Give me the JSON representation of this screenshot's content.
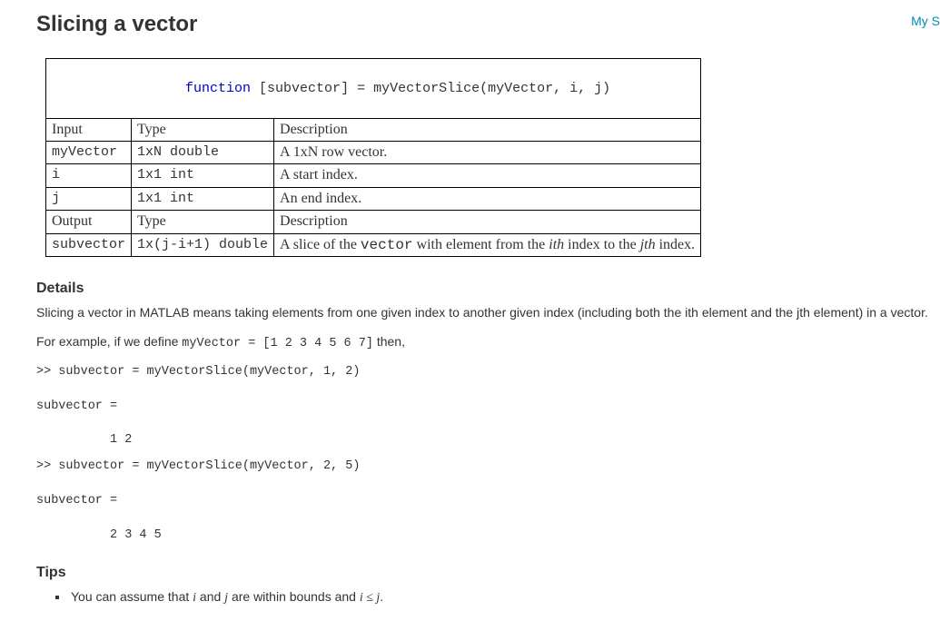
{
  "nav": {
    "link": "My S"
  },
  "title": "Slicing a vector",
  "signature": {
    "keyword": "function",
    "rest": " [subvector] = myVectorSlice(myVector, i, j)"
  },
  "table": {
    "input_header": {
      "c1": "Input",
      "c2": "Type",
      "c3": "Description"
    },
    "inputs": [
      {
        "name": "myVector",
        "type": "1xN double",
        "desc": "A 1xN row vector."
      },
      {
        "name": "i",
        "type": "1x1 int",
        "desc": "A start index."
      },
      {
        "name": "j",
        "type": "1x1 int",
        "desc": "An end index."
      }
    ],
    "output_header": {
      "c1": "Output",
      "c2": "Type",
      "c3": "Description"
    },
    "outputs": [
      {
        "name": "subvector",
        "type": "1x(j-i+1) double",
        "desc_pre": "A slice of the ",
        "desc_code": "vector",
        "desc_mid": " with element from the ",
        "desc_i": "ith",
        "desc_to": " index to the ",
        "desc_j": "jth",
        "desc_post": " index."
      }
    ]
  },
  "details": {
    "heading": "Details",
    "para1": "Slicing a vector in MATLAB means taking elements from one given index to another given index (including both the ith element and the jth element) in a vector.",
    "para2_pre": "For example, if we define ",
    "para2_code": "myVector = [1 2 3 4 5 6 7]",
    "para2_post": " then,",
    "code1": ">> subvector = myVectorSlice(myVector, 1, 2)\n\nsubvector =\n\n          1 2",
    "code2": ">> subvector = myVectorSlice(myVector, 2, 5)\n\nsubvector =\n\n          2 3 4 5"
  },
  "tips": {
    "heading": "Tips",
    "item1_pre": "You can assume that ",
    "item1_i": "i",
    "item1_mid1": " and ",
    "item1_j": "j",
    "item1_mid2": " are within bounds and ",
    "item1_ij": "i ≤ j",
    "item1_post": "."
  }
}
